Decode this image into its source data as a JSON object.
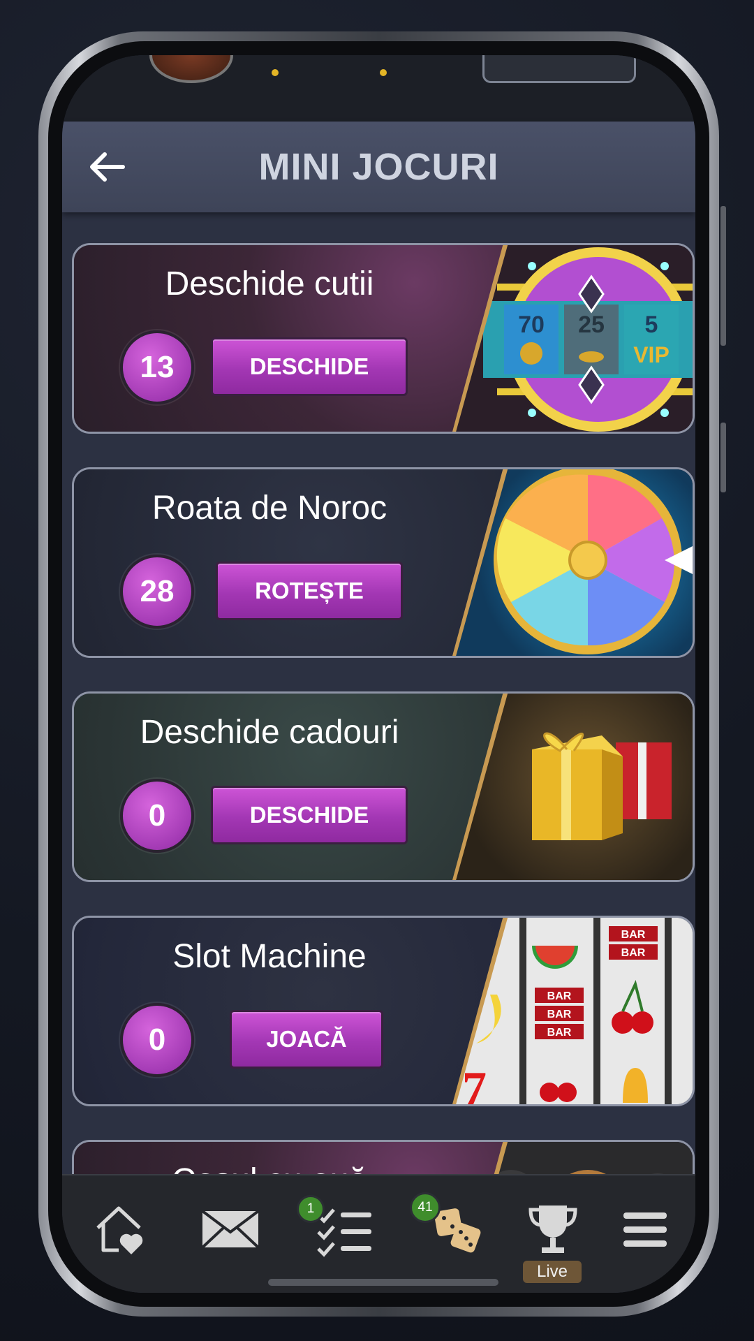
{
  "header": {
    "title": "MINI JOCURI"
  },
  "games": [
    {
      "name": "Deschide cutii",
      "count": "13",
      "action": "DESCHIDE"
    },
    {
      "name": "Roata de Noroc",
      "count": "28",
      "action": "ROTEȘTE"
    },
    {
      "name": "Deschide cadouri",
      "count": "0",
      "action": "DESCHIDE"
    },
    {
      "name": "Slot Machine",
      "count": "0",
      "action": "JOACĂ"
    },
    {
      "name": "Coșul cu ouă"
    }
  ],
  "box_art": {
    "slot1": "70",
    "slot2": "25",
    "slot3": "5",
    "slot3_label": "VIP"
  },
  "slot_art": {
    "symbol": "BAR"
  },
  "bottom_nav": {
    "items": [
      "home-icon",
      "mail-icon",
      "tasks-icon",
      "games-icon",
      "trophy-icon",
      "menu-icon"
    ],
    "tasks_badge": "1",
    "games_badge": "41",
    "live_label": "Live"
  },
  "colors": {
    "accent": "#b341c4",
    "header": "#444a60",
    "badge_green": "#3f8d2c"
  }
}
